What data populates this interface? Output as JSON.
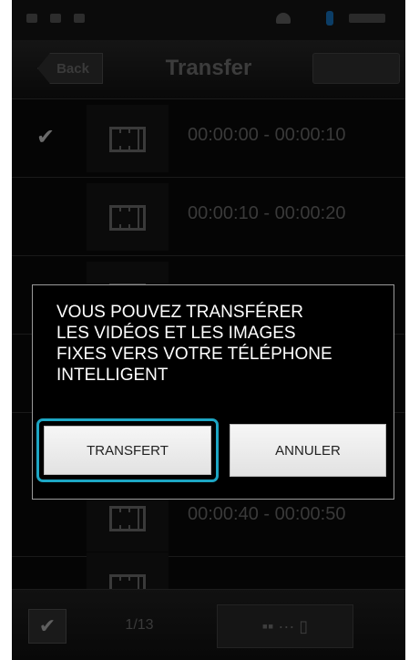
{
  "header": {
    "back_label": "Back",
    "title": "Transfer"
  },
  "rows": [
    {
      "time": "00:00:00 - 00:00:10",
      "checked": true
    },
    {
      "time": "00:00:10 - 00:00:20",
      "checked": false
    },
    {
      "time": "00:00:40 - 00:00:50",
      "checked": false
    }
  ],
  "dialog": {
    "message_lines": [
      "VOUS POUVEZ TRANSFÉRER",
      "LES VIDÉOS ET LES IMAGES",
      "FIXES VERS VOTRE TÉLÉPHONE",
      "INTELLIGENT"
    ],
    "transfer_label": "TRANSFERT",
    "cancel_label": "ANNULER"
  },
  "footer": {
    "page_count": "1/13",
    "check_glyph": "✔",
    "transfer_icon": "camera-to-phone-icon"
  },
  "colors": {
    "highlight": "#1da6c4"
  }
}
